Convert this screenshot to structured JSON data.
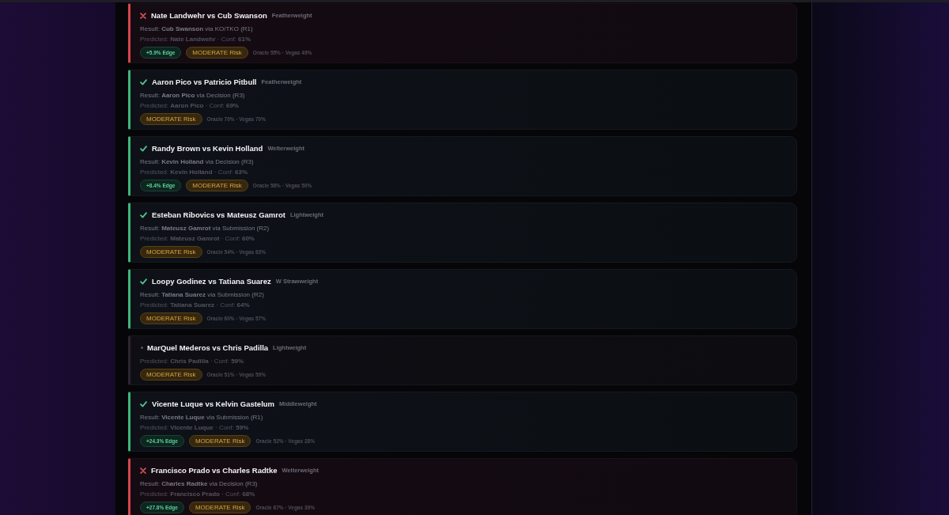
{
  "fights": [
    {
      "kind": "miss",
      "matchup": "Nate Landwehr vs Cub Swanson",
      "weight_class": "Featherweight",
      "result": "Result: **Cub Swanson** via KO/TKO (R1)",
      "prediction": "Predicted: **Nate Landwehr** · Conf: **61%**",
      "edge": "+5.9% Edge",
      "risk": "MODERATE Risk",
      "odds": "Oracle 55% · Vegas 49%"
    },
    {
      "kind": "hit",
      "matchup": "Aaron Pico vs Patricio Pitbull",
      "weight_class": "Featherweight",
      "result": "Result: **Aaron Pico** via Decision (R3)",
      "prediction": "Predicted: **Aaron Pico** · Conf: **69%**",
      "risk": "MODERATE Risk",
      "odds": "Oracle 70% · Vegas 70%"
    },
    {
      "kind": "hit",
      "matchup": "Randy Brown vs Kevin Holland",
      "weight_class": "Welterweight",
      "result": "Result: **Kevin Holland** via Decision (R3)",
      "prediction": "Predicted: **Kevin Holland** · Conf: **63%**",
      "edge": "+8.4% Edge",
      "risk": "MODERATE Risk",
      "odds": "Oracle 58% · Vegas 50%"
    },
    {
      "kind": "hit",
      "matchup": "Esteban Ribovics vs Mateusz Gamrot",
      "weight_class": "Lightweight",
      "result": "Result: **Mateusz Gamrot** via Submission (R2)",
      "prediction": "Predicted: **Mateusz Gamrot** · Conf: **60%**",
      "risk": "MODERATE Risk",
      "odds": "Oracle 54% · Vegas 63%"
    },
    {
      "kind": "hit",
      "matchup": "Loopy Godinez vs Tatiana Suarez",
      "weight_class": "W Strawweight",
      "result": "Result: **Tatiana Suarez** via Submission (R2)",
      "prediction": "Predicted: **Tatiana Suarez** · Conf: **64%**",
      "risk": "MODERATE Risk",
      "odds": "Oracle 60% · Vegas 57%"
    },
    {
      "kind": "pending",
      "matchup": "MarQuel Mederos vs Chris Padilla",
      "weight_class": "Lightweight",
      "prediction": "Predicted: **Chris Padilla** · Conf: **59%**",
      "risk": "MODERATE Risk",
      "odds": "Oracle 51% · Vegas 59%"
    },
    {
      "kind": "hit",
      "matchup": "Vicente Luque vs Kelvin Gastelum",
      "weight_class": "Middleweight",
      "result": "Result: **Vicente Luque** via Submission (R1)",
      "prediction": "Predicted: **Vicente Luque** · Conf: **59%**",
      "edge": "+24.3% Edge",
      "risk": "MODERATE Risk",
      "odds": "Oracle 52% · Vegas 28%"
    },
    {
      "kind": "miss",
      "matchup": "Francisco Prado vs Charles Radtke",
      "weight_class": "Welterweight",
      "result": "Result: **Charles Radtke** via Decision (R3)",
      "prediction": "Predicted: **Francisco Prado** · Conf: **68%**",
      "edge": "+27.8% Edge",
      "risk": "MODERATE Risk",
      "odds": "Oracle 67% · Vegas 39%"
    }
  ]
}
